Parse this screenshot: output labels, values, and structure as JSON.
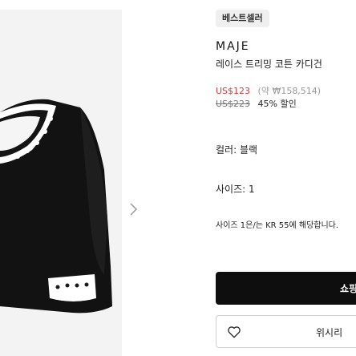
{
  "badge": "베스트셀러",
  "brand": "MAJE",
  "product_name": "레이스 트리밍 코튼 카디건",
  "price": {
    "current": "US$123",
    "approx": "(약 ₩158,514)",
    "original": "US$223",
    "discount": "45% 할인"
  },
  "color_line": "컬러: 블랙",
  "size_line": "사이즈: 1",
  "size_note": "사이즈 1은/는 KR 55에 해당합니다.",
  "buttons": {
    "buy": "쇼핑",
    "wishlist": "위시리"
  },
  "icons": {
    "gallery_next": "chevron-right-icon",
    "wishlist": "heart-icon"
  },
  "colors": {
    "sale_price": "#d63a3a",
    "buy_button": "#0e0e0e",
    "badge_bg": "#efefef"
  }
}
